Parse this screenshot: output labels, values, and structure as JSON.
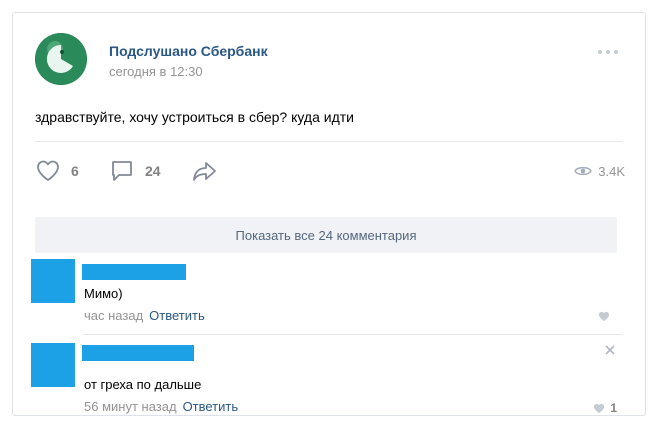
{
  "post": {
    "group_name": "Подслушано Сбербанк",
    "time": "сегодня в 12:30",
    "text": "здравствуйте, хочу устроиться в сбер? куда идти",
    "likes": "6",
    "comments": "24",
    "views": "3.4K",
    "show_all_comments": "Показать все 24 комментария"
  },
  "icons": {
    "more": "more-icon",
    "like": "heart-icon",
    "comment": "comment-icon",
    "share": "share-icon",
    "views": "eye-icon",
    "close": "close-icon"
  },
  "comments": [
    {
      "text": "Мимо)",
      "time": "час назад",
      "reply": "Ответить",
      "likes": ""
    },
    {
      "text": "от греха по дальше",
      "time": "56 минут назад",
      "reply": "Ответить",
      "likes": "1"
    }
  ],
  "colors": {
    "link": "#2a5885",
    "muted": "#939393",
    "redaction": "#1da1e6",
    "panel": "#f0f2f5"
  }
}
